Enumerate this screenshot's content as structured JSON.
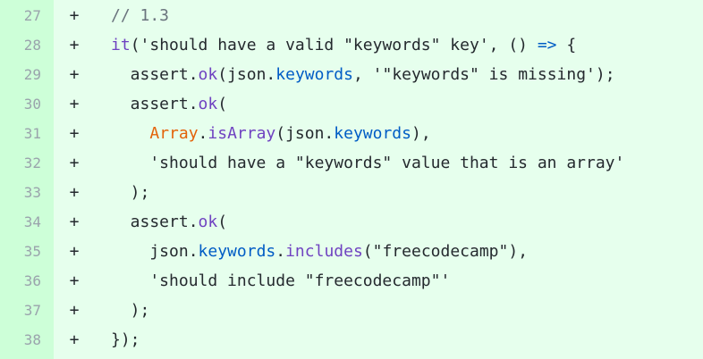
{
  "colors": {
    "added_background": "#e6ffed",
    "gutter_background": "#cdffd8",
    "line_number": "#9aa3ac",
    "comment": "#6a737d",
    "function": "#6f42c1",
    "property": "#005cc5",
    "builtin": "#e36209",
    "text": "#24292e"
  },
  "lines": [
    {
      "number": "27",
      "marker": "+",
      "tokens": [
        {
          "text": "// 1.3",
          "kind": "comment"
        }
      ]
    },
    {
      "number": "28",
      "marker": "+",
      "tokens": [
        {
          "text": "it",
          "kind": "func"
        },
        {
          "text": "('should have a valid \"keywords\" key', () ",
          "kind": "plain"
        },
        {
          "text": "=>",
          "kind": "arrow"
        },
        {
          "text": " {",
          "kind": "plain"
        }
      ]
    },
    {
      "number": "29",
      "marker": "+",
      "tokens": [
        {
          "text": "  assert.",
          "kind": "plain"
        },
        {
          "text": "ok",
          "kind": "func"
        },
        {
          "text": "(json.",
          "kind": "plain"
        },
        {
          "text": "keywords",
          "kind": "prop"
        },
        {
          "text": ", '\"keywords\" is missing');",
          "kind": "plain"
        }
      ]
    },
    {
      "number": "30",
      "marker": "+",
      "tokens": [
        {
          "text": "  assert.",
          "kind": "plain"
        },
        {
          "text": "ok",
          "kind": "func"
        },
        {
          "text": "(",
          "kind": "plain"
        }
      ]
    },
    {
      "number": "31",
      "marker": "+",
      "tokens": [
        {
          "text": "    ",
          "kind": "plain"
        },
        {
          "text": "Array",
          "kind": "builtin"
        },
        {
          "text": ".",
          "kind": "plain"
        },
        {
          "text": "isArray",
          "kind": "func"
        },
        {
          "text": "(json.",
          "kind": "plain"
        },
        {
          "text": "keywords",
          "kind": "prop"
        },
        {
          "text": "),",
          "kind": "plain"
        }
      ]
    },
    {
      "number": "32",
      "marker": "+",
      "tokens": [
        {
          "text": "    'should have a \"keywords\" value that is an array'",
          "kind": "plain"
        }
      ]
    },
    {
      "number": "33",
      "marker": "+",
      "tokens": [
        {
          "text": "  );",
          "kind": "plain"
        }
      ]
    },
    {
      "number": "34",
      "marker": "+",
      "tokens": [
        {
          "text": "  assert.",
          "kind": "plain"
        },
        {
          "text": "ok",
          "kind": "func"
        },
        {
          "text": "(",
          "kind": "plain"
        }
      ]
    },
    {
      "number": "35",
      "marker": "+",
      "tokens": [
        {
          "text": "    json.",
          "kind": "plain"
        },
        {
          "text": "keywords",
          "kind": "prop"
        },
        {
          "text": ".",
          "kind": "plain"
        },
        {
          "text": "includes",
          "kind": "func"
        },
        {
          "text": "(\"freecodecamp\"),",
          "kind": "plain"
        }
      ]
    },
    {
      "number": "36",
      "marker": "+",
      "tokens": [
        {
          "text": "    'should include \"freecodecamp\"'",
          "kind": "plain"
        }
      ]
    },
    {
      "number": "37",
      "marker": "+",
      "tokens": [
        {
          "text": "  );",
          "kind": "plain"
        }
      ]
    },
    {
      "number": "38",
      "marker": "+",
      "tokens": [
        {
          "text": "});",
          "kind": "plain"
        }
      ]
    }
  ]
}
